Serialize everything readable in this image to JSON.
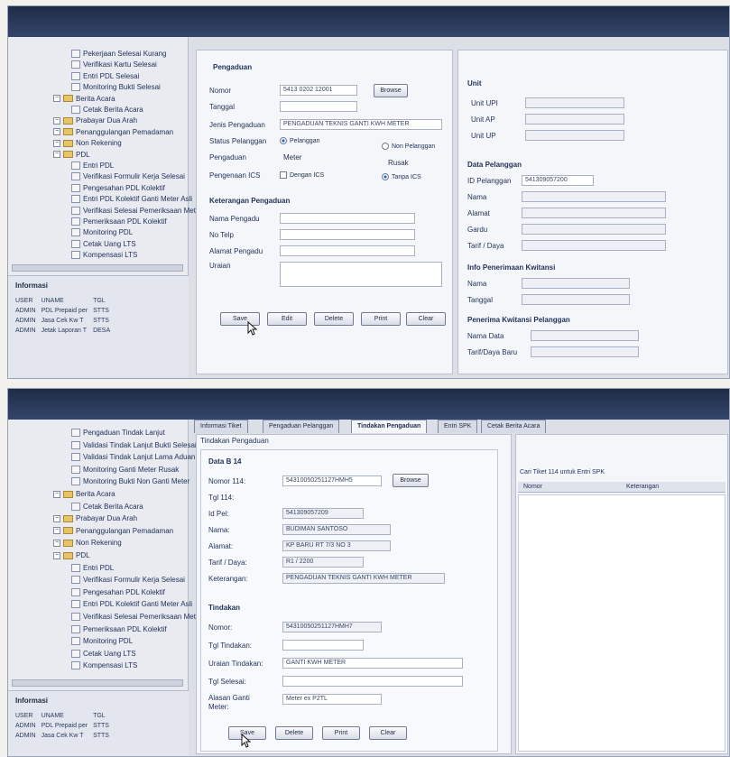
{
  "screenshot1": {
    "title_left": "",
    "title_center": "",
    "title_right": "",
    "sidebar_header": "",
    "tree": [
      {
        "label": "Pekerjaan Selesai Kurang",
        "type": "doc"
      },
      {
        "label": "Verifikasi Kartu Selesai",
        "type": "doc"
      },
      {
        "label": "Entri PDL Selesai",
        "type": "doc"
      },
      {
        "label": "Monitoring Bukti Selesai",
        "type": "doc"
      },
      {
        "label": "Berita Acara",
        "type": "folder"
      },
      {
        "label": "Cetak Berita Acara",
        "type": "doc"
      },
      {
        "label": "Prabayar Dua Arah",
        "type": "folder"
      },
      {
        "label": "Penanggulangan Pemadaman",
        "type": "folder"
      },
      {
        "label": "Non Rekening",
        "type": "folder"
      },
      {
        "label": "PDL",
        "type": "folder"
      },
      {
        "label": "Entri PDL",
        "type": "doc"
      },
      {
        "label": "Verifikasi Formulir Kerja Selesai",
        "type": "doc"
      },
      {
        "label": "Pengesahan PDL Kolektif",
        "type": "doc"
      },
      {
        "label": "Entri PDL Kolektif Ganti Meter Asli",
        "type": "doc"
      },
      {
        "label": "Verifikasi Selesai Pemeriksaan Meter",
        "type": "doc"
      },
      {
        "label": "Pemeriksaan PDL Kolektif",
        "type": "doc"
      },
      {
        "label": "Monitoring PDL",
        "type": "doc"
      },
      {
        "label": "Cetak Uang LTS",
        "type": "doc"
      },
      {
        "label": "Kompensasi LTS",
        "type": "doc"
      }
    ],
    "info": {
      "title": "Informasi",
      "rows": [
        [
          "USER",
          "UNAME",
          "TGL"
        ],
        [
          "ADMIN",
          "PDL Prepaid per",
          "STTS"
        ],
        [
          "ADMIN",
          "Jasa Cek Kw T",
          "STTS"
        ],
        [
          "ADMIN",
          "Jetak Laporan T",
          "DESA"
        ]
      ]
    },
    "form": {
      "section_title": "Pengaduan",
      "nomor_label": "Nomor",
      "nomor_value": "5413 0202 12001",
      "browse_label": "Browse",
      "tanggal_label": "Tanggal",
      "jenis_label": "Jenis Pengaduan",
      "jenis_value": "PENGADUAN TEKNIS GANTI KWH METER",
      "status_label": "Status Pelanggan",
      "status_opt1": "Pelanggan",
      "status_opt2": "Non Pelanggan",
      "pengaduan_label": "Pengaduan",
      "pengaduan_value": "Meter",
      "pengaduan_opt": "Rusak",
      "pengenaan_label": "Pengenaan ICS",
      "pengenaan_opt1": "Dengan ICS",
      "pengenaan_opt2": "Tanpa ICS",
      "kelompok_title": "Keterangan Pengaduan",
      "nama_label": "Nama Pengadu",
      "telp_label": "No Telp",
      "alamat_label": "Alamat Pengadu",
      "uraian_label": "Uraian",
      "buttons": [
        "Save",
        "Edit",
        "Delete",
        "Print",
        "Clear"
      ]
    },
    "right": {
      "section1": "Unit",
      "unit_rows": [
        "Unit UPI",
        "Unit AP",
        "Unit UP"
      ],
      "section2": "Data Pelanggan",
      "idpel_label": "ID Pelanggan",
      "idpel_value": "541309057200",
      "nama_label": "Nama",
      "alamat_label": "Alamat",
      "gardu_label": "Gardu",
      "tarif_label": "Tarif / Daya",
      "section3": "Info Penerimaan Kwitansi",
      "r_nama": "Nama",
      "r_tanggal": "Tanggal",
      "section4": "Penerima Kwitansi Pelanggan",
      "p_nama": "Nama Data",
      "p_tarif": "Tarif/Daya Baru"
    }
  },
  "screenshot2": {
    "title_left": "",
    "title_right": "",
    "tabs": [
      "Informasi Tiket",
      "Pengaduan Pelanggan",
      "Tindakan Pengaduan",
      "Entri SPK",
      "Cetak Berita Acara"
    ],
    "sidebar_header": "",
    "tree": [
      {
        "label": "Pengaduan Tindak Lanjut",
        "type": "doc"
      },
      {
        "label": "Validasi Tindak Lanjut Bukti Selesai",
        "type": "doc"
      },
      {
        "label": "Validasi Tindak Lanjut Lama Aduan",
        "type": "doc"
      },
      {
        "label": "Monitoring Ganti Meter Rusak",
        "type": "doc"
      },
      {
        "label": "Monitoring Bukti Non Ganti Meter",
        "type": "doc"
      },
      {
        "label": "Berita Acara",
        "type": "folder"
      },
      {
        "label": "Cetak Berita Acara",
        "type": "doc"
      },
      {
        "label": "Prabayar Dua Arah",
        "type": "folder"
      },
      {
        "label": "Penanggulangan Pemadaman",
        "type": "folder"
      },
      {
        "label": "Non Rekening",
        "type": "folder"
      },
      {
        "label": "PDL",
        "type": "folder"
      },
      {
        "label": "Entri PDL",
        "type": "doc"
      },
      {
        "label": "Verifikasi Formulir Kerja Selesai",
        "type": "doc"
      },
      {
        "label": "Pengesahan PDL Kolektif",
        "type": "doc"
      },
      {
        "label": "Entri PDL Kolektif Ganti Meter Asli",
        "type": "doc"
      },
      {
        "label": "Verifikasi Selesai Pemeriksaan Meter",
        "type": "doc"
      },
      {
        "label": "Pemeriksaan PDL Kolektif",
        "type": "doc"
      },
      {
        "label": "Monitoring PDL",
        "type": "doc"
      },
      {
        "label": "Cetak Uang LTS",
        "type": "doc"
      },
      {
        "label": "Kompensasi LTS",
        "type": "doc"
      }
    ],
    "info": {
      "title": "Informasi",
      "rows": [
        [
          "USER",
          "UNAME",
          "TGL"
        ],
        [
          "ADMIN",
          "PDL Prepaid per",
          "STTS"
        ],
        [
          "ADMIN",
          "Jasa Cek Kw T",
          "STTS"
        ]
      ]
    },
    "form": {
      "panel_title": "Tindakan Pengaduan",
      "section1": "Data B 14",
      "nomor_label": "Nomor 114:",
      "nomor_value": "54310050251127HMH5",
      "browse_label": "Browse",
      "tgl114_label": "Tgl 114:",
      "idpel_label": "Id Pel:",
      "idpel_value": "541309057209",
      "nama_label": "Nama:",
      "nama_value": "BUDIMAN SANTOSO",
      "alamat_label": "Alamat:",
      "alamat_value": "KP BARU RT 7/3 NO 3",
      "tarif_label": "Tarif / Daya:",
      "tarif_value": "R1  /  2200",
      "ket_label": "Keterangan:",
      "ket_value": "PENGADUAN TEKNIS GANTI KWH METER",
      "section2": "Tindakan",
      "t_nomor_label": "Nomor:",
      "t_nomor_value": "54310050251127HMH7",
      "tgl_tindakan_label": "Tgl Tindakan:",
      "uraian_label": "Uraian Tindakan:",
      "uraian_value": "GANTI KWH METER",
      "tgl_selesai_label": "Tgl Selesai:",
      "alasan_label": "Alasan Ganti Meter:",
      "alasan_value": "Meter ex P2TL",
      "buttons": [
        "Save",
        "Delete",
        "Print",
        "Clear"
      ]
    },
    "right": {
      "title": "Cari Tiket 114 untuk Entri SPK",
      "col1": "Nomor",
      "col2": "Keterangan"
    }
  }
}
